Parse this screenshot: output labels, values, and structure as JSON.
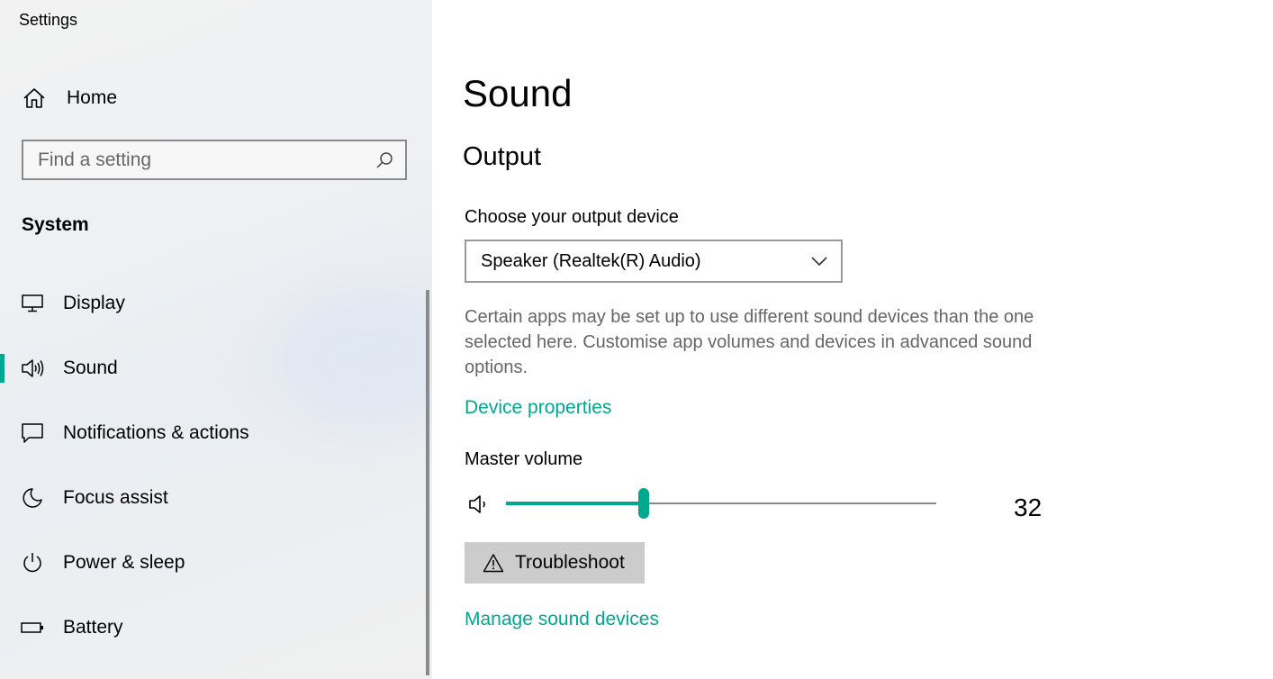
{
  "app": {
    "title": "Settings"
  },
  "sidebar": {
    "home_label": "Home",
    "search": {
      "placeholder": "Find a setting",
      "value": ""
    },
    "section": "System",
    "items": [
      {
        "label": "Display",
        "icon": "display-icon"
      },
      {
        "label": "Sound",
        "icon": "speaker-icon",
        "selected": true
      },
      {
        "label": "Notifications & actions",
        "icon": "notification-icon"
      },
      {
        "label": "Focus assist",
        "icon": "moon-icon"
      },
      {
        "label": "Power & sleep",
        "icon": "power-icon"
      },
      {
        "label": "Battery",
        "icon": "battery-icon"
      }
    ]
  },
  "main": {
    "title": "Sound",
    "output": {
      "heading": "Output",
      "device_label": "Choose your output device",
      "device_value": "Speaker (Realtek(R) Audio)",
      "info": "Certain apps may be set up to use different sound devices than the one selected here. Customise app volumes and devices in advanced sound options.",
      "device_properties_link": "Device properties",
      "master_volume_label": "Master volume",
      "volume": 32,
      "troubleshoot_label": "Troubleshoot",
      "manage_link": "Manage sound devices"
    }
  },
  "colors": {
    "accent": "#00a88f",
    "link": "#00a88f",
    "button_bg": "#cccccc"
  }
}
